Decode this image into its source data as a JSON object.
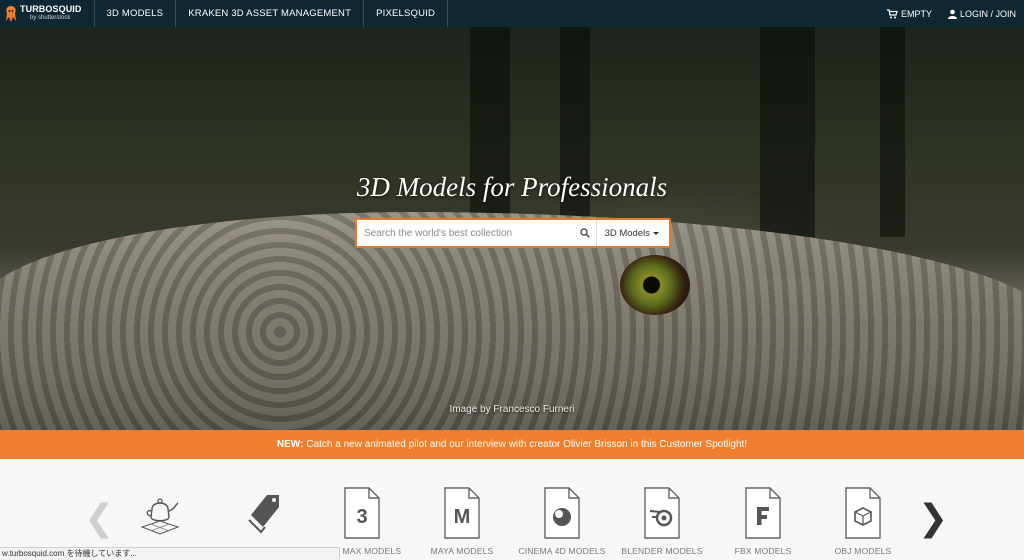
{
  "nav": {
    "logo_title": "TURBOSQUID",
    "logo_sub": "by shutterstock",
    "items": [
      "3D MODELS",
      "KRAKEN 3D ASSET MANAGEMENT",
      "PIXELSQUID"
    ],
    "cart_label": "EMPTY",
    "login_label": "LOGIN / JOIN"
  },
  "hero": {
    "title": "3D Models for Professionals",
    "search_placeholder": "Search the world's best collection",
    "search_category": "3D Models",
    "credit": "Image by Francesco Furneri"
  },
  "banner": {
    "prefix": "NEW:",
    "text": "Catch a new animated pilot and our interview with creator Olivier Brisson in this Customer Spotlight!"
  },
  "categories": [
    {
      "label": "",
      "icon": "teapot-icon"
    },
    {
      "label": "",
      "icon": "tag-icon"
    },
    {
      "label": "3DS MAX MODELS",
      "glyph": "3"
    },
    {
      "label": "MAYA MODELS",
      "glyph": "M"
    },
    {
      "label": "CINEMA 4D MODELS",
      "glyph": "C4D"
    },
    {
      "label": "BLENDER MODELS",
      "glyph": "B"
    },
    {
      "label": "FBX MODELS",
      "glyph": "F"
    },
    {
      "label": "OBJ MODELS",
      "glyph": "OBJ"
    }
  ],
  "status_text": "w.turbosquid.com を待機しています...",
  "colors": {
    "nav_bg": "#0f2732",
    "accent": "#f07f2d"
  }
}
